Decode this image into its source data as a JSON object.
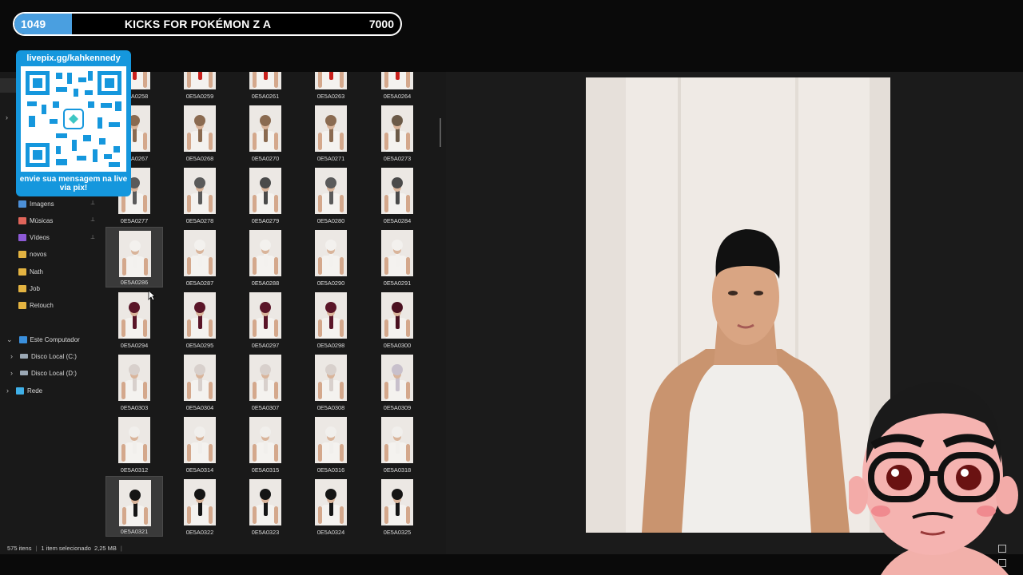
{
  "goal": {
    "current": "1049",
    "title": "KICKS FOR POKÉMON Z A",
    "target": "7000",
    "progress_fraction": 0.15,
    "fill_color": "#4a9fe0"
  },
  "qr_overlay": {
    "url": "livepix.gg/kahkennedy",
    "message": "envie sua mensagem na live via pix!",
    "bg_color": "#1597dd"
  },
  "sidebar": {
    "quick_access": [
      {
        "label": "Imagens",
        "icon": "pictures-icon",
        "pinned": true
      },
      {
        "label": "Músicas",
        "icon": "music-icon",
        "pinned": true
      },
      {
        "label": "Vídeos",
        "icon": "videos-icon",
        "pinned": true
      },
      {
        "label": "novos",
        "icon": "folder-icon",
        "pinned": false
      },
      {
        "label": "Nath",
        "icon": "folder-icon",
        "pinned": false
      },
      {
        "label": "Job",
        "icon": "folder-icon",
        "pinned": false
      },
      {
        "label": "Retouch",
        "icon": "folder-icon",
        "pinned": false
      }
    ],
    "computer": {
      "label": "Este Computador",
      "drives": [
        "Disco Local (C:)",
        "Disco Local (D:)"
      ]
    },
    "network": "Rede"
  },
  "files": {
    "rows": [
      [
        {
          "name": "0E5A0258",
          "hair": "#c8201c"
        },
        {
          "name": "0E5A0259",
          "hair": "#c8201c"
        },
        {
          "name": "0E5A0261",
          "hair": "#c8201c"
        },
        {
          "name": "0E5A0263",
          "hair": "#c8201c"
        },
        {
          "name": "0E5A0264",
          "hair": "#c8201c"
        }
      ],
      [
        {
          "name": "0E5A0267",
          "hair": "#8a6a50"
        },
        {
          "name": "0E5A0268",
          "hair": "#8a6a50"
        },
        {
          "name": "0E5A0270",
          "hair": "#8a6a50"
        },
        {
          "name": "0E5A0271",
          "hair": "#8a6a50"
        },
        {
          "name": "0E5A0273",
          "hair": "#6b5a48"
        }
      ],
      [
        {
          "name": "0E5A0277",
          "hair": "#5a5a5a"
        },
        {
          "name": "0E5A0278",
          "hair": "#5a5a5a"
        },
        {
          "name": "0E5A0279",
          "hair": "#4a4a4a"
        },
        {
          "name": "0E5A0280",
          "hair": "#5a5a5a"
        },
        {
          "name": "0E5A0284",
          "hair": "#4a4a4a"
        }
      ],
      [
        {
          "name": "0E5A0286",
          "hair": "#f3f1ee",
          "selected": true
        },
        {
          "name": "0E5A0287",
          "hair": "#f3f1ee"
        },
        {
          "name": "0E5A0288",
          "hair": "#f3f1ee"
        },
        {
          "name": "0E5A0290",
          "hair": "#f3f1ee"
        },
        {
          "name": "0E5A0291",
          "hair": "#f3f1ee"
        }
      ],
      [
        {
          "name": "0E5A0294",
          "hair": "#5a1528"
        },
        {
          "name": "0E5A0295",
          "hair": "#5a1528"
        },
        {
          "name": "0E5A0297",
          "hair": "#5a1528"
        },
        {
          "name": "0E5A0298",
          "hair": "#5a1528"
        },
        {
          "name": "0E5A0300",
          "hair": "#4a1020"
        }
      ],
      [
        {
          "name": "0E5A0303",
          "hair": "#d8d0cc"
        },
        {
          "name": "0E5A0304",
          "hair": "#d8d0cc"
        },
        {
          "name": "0E5A0307",
          "hair": "#d8d0cc"
        },
        {
          "name": "0E5A0308",
          "hair": "#d8d0cc"
        },
        {
          "name": "0E5A0309",
          "hair": "#c8c0cc"
        }
      ],
      [
        {
          "name": "0E5A0312",
          "hair": "#f1efec"
        },
        {
          "name": "0E5A0314",
          "hair": "#f1efec"
        },
        {
          "name": "0E5A0315",
          "hair": "#f1efec"
        },
        {
          "name": "0E5A0316",
          "hair": "#f1efec"
        },
        {
          "name": "0E5A0318",
          "hair": "#f1efec"
        }
      ],
      [
        {
          "name": "0E5A0321",
          "hair": "#151515",
          "selected": true
        },
        {
          "name": "0E5A0322",
          "hair": "#151515"
        },
        {
          "name": "0E5A0323",
          "hair": "#151515"
        },
        {
          "name": "0E5A0324",
          "hair": "#151515"
        },
        {
          "name": "0E5A0325",
          "hair": "#151515"
        }
      ]
    ]
  },
  "status": {
    "count": "575 itens",
    "selection": "1 item selecionado",
    "size": "2,25 MB"
  }
}
